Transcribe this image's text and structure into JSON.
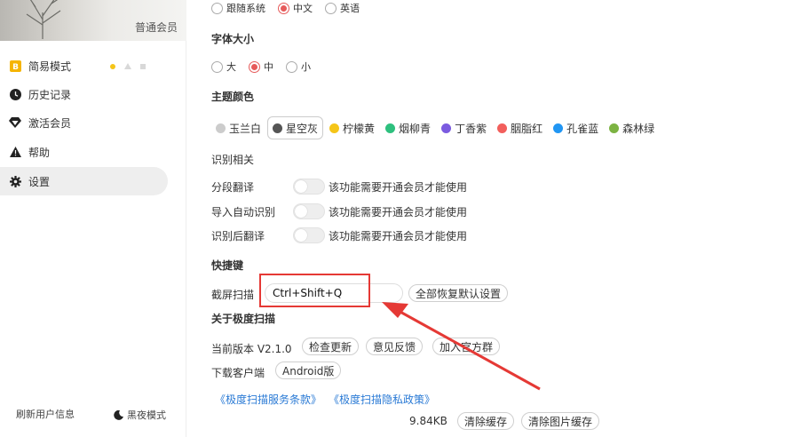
{
  "sidebar": {
    "member_label": "普通会员",
    "items": [
      {
        "label": "简易模式",
        "icon": "b-badge-icon"
      },
      {
        "label": "历史记录",
        "icon": "clock-icon"
      },
      {
        "label": "激活会员",
        "icon": "diamond-icon"
      },
      {
        "label": "帮助",
        "icon": "warning-icon"
      },
      {
        "label": "设置",
        "icon": "gear-icon"
      }
    ],
    "refresh_label": "刷新用户信息",
    "night_label": "黑夜模式"
  },
  "language": {
    "options": [
      "跟随系统",
      "中文",
      "英语"
    ],
    "selected": "中文"
  },
  "font_size": {
    "title": "字体大小",
    "options": [
      "大",
      "中",
      "小"
    ],
    "selected": "中"
  },
  "theme": {
    "title": "主题颜色",
    "selected": "星空灰",
    "items": [
      {
        "label": "玉兰白",
        "color": "#cccccc"
      },
      {
        "label": "星空灰",
        "color": "#555555"
      },
      {
        "label": "柠檬黄",
        "color": "#f5c518"
      },
      {
        "label": "烟柳青",
        "color": "#2ec07e"
      },
      {
        "label": "丁香紫",
        "color": "#7b5be0"
      },
      {
        "label": "胭脂红",
        "color": "#f25f5c"
      },
      {
        "label": "孔雀蓝",
        "color": "#2196f3"
      },
      {
        "label": "森林绿",
        "color": "#7cb342"
      }
    ]
  },
  "recognition": {
    "title": "识别相关",
    "features": [
      {
        "label": "分段翻译",
        "note": "该功能需要开通会员才能使用"
      },
      {
        "label": "导入自动识别",
        "note": "该功能需要开通会员才能使用"
      },
      {
        "label": "识别后翻译",
        "note": "该功能需要开通会员才能使用"
      }
    ]
  },
  "shortcuts": {
    "title": "快捷键",
    "screenshot_label": "截屏扫描",
    "screenshot_value": "Ctrl+Shift+Q",
    "reset_label": "全部恢复默认设置"
  },
  "about": {
    "title": "关于极度扫描",
    "version_label": "当前版本 V2.1.0",
    "check_update": "检查更新",
    "feedback": "意见反馈",
    "join_group": "加入官方群",
    "download_label": "下载客户端",
    "android_label": "Android版",
    "terms_link": "《极度扫描服务条款》",
    "privacy_link": "《极度扫描隐私政策》"
  },
  "cache": {
    "size": "9.84KB",
    "clear_cache": "清除缓存",
    "clear_image_cache": "清除图片缓存"
  },
  "colors": {
    "accent_red": "#e65a5a",
    "annotation_red": "#e53935",
    "link_blue": "#2a7ad5"
  }
}
